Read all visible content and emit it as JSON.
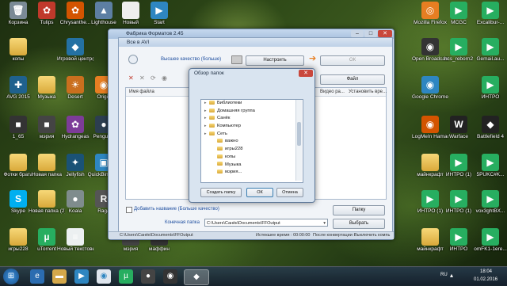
{
  "desktop": {
    "left_icons": [
      {
        "label": "Корзина",
        "glyph": "🗑",
        "color": "#7a8a95"
      },
      {
        "label": "Tulips",
        "glyph": "✿",
        "color": "#c0392b"
      },
      {
        "label": "Chrysanthe...",
        "glyph": "✿",
        "color": "#d35400"
      },
      {
        "label": "Lighthouse",
        "glyph": "▲",
        "color": "#5d7fa3"
      },
      {
        "label": "Новый",
        "glyph": "",
        "color": "#eeeeee"
      },
      {
        "label": "Start",
        "glyph": "▶",
        "color": "#2e86c1"
      },
      {
        "label": "копы",
        "glyph": "",
        "color": "folder"
      },
      {
        "label": "Игровой центр@Ma...",
        "glyph": "◆",
        "color": "#2471a3"
      },
      {
        "label": "AVG 2015",
        "glyph": "✚",
        "color": "#1f618d"
      },
      {
        "label": "Музыка",
        "glyph": "",
        "color": "folder"
      },
      {
        "label": "Desert",
        "glyph": "☀",
        "color": "#ca6f1e"
      },
      {
        "label": "Origin",
        "glyph": "◉",
        "color": "#e67e22"
      },
      {
        "label": "1_65",
        "glyph": "■",
        "color": "#333333"
      },
      {
        "label": "мэрия",
        "glyph": "■",
        "color": "#444444"
      },
      {
        "label": "Hydrangeas",
        "glyph": "✿",
        "color": "#7d3c98"
      },
      {
        "label": "Penguins",
        "glyph": "●",
        "color": "#2c3e50"
      },
      {
        "label": "Фотки брата",
        "glyph": "",
        "color": "folder"
      },
      {
        "label": "Новая папка",
        "glyph": "",
        "color": "folder"
      },
      {
        "label": "Jellyfish",
        "glyph": "✦",
        "color": "#1a5276"
      },
      {
        "label": "QuickBinder 3",
        "glyph": "▣",
        "color": "#2e86c1"
      },
      {
        "label": "Skype",
        "glyph": "S",
        "color": "#00aff0"
      },
      {
        "label": "Новая папка (2)",
        "glyph": "",
        "color": "folder"
      },
      {
        "label": "Koala",
        "glyph": "●",
        "color": "#7f8c8d"
      },
      {
        "label": "Raga",
        "glyph": "R",
        "color": "#555555"
      },
      {
        "label": "игры228",
        "glyph": "",
        "color": "folder"
      },
      {
        "label": "uTorrent",
        "glyph": "µ",
        "color": "#27ae60"
      },
      {
        "label": "Новый текстовый...",
        "glyph": "≡",
        "color": "#ecf0f1"
      },
      {
        "label": "мэрия",
        "glyph": "■",
        "color": "#444444"
      },
      {
        "label": "маффин",
        "glyph": "■",
        "color": "#333333"
      }
    ],
    "right_icons": [
      {
        "label": "Mozilla Firefox",
        "glyph": "◎",
        "color": "#e67e22"
      },
      {
        "label": "MCGC",
        "glyph": "▶",
        "color": "#27ae60"
      },
      {
        "label": "Excalibur-...",
        "glyph": "▶",
        "color": "#27ae60"
      },
      {
        "label": "Open Broadcast...",
        "glyph": "◉",
        "color": "#333333"
      },
      {
        "label": "hcs_reborn2",
        "glyph": "▶",
        "color": "#27ae60"
      },
      {
        "label": "Gemail.au...",
        "glyph": "▶",
        "color": "#27ae60"
      },
      {
        "label": "Google Chrome",
        "glyph": "◉",
        "color": "#2e86c1"
      },
      {
        "label": "ИНТРО",
        "glyph": "▶",
        "color": "#27ae60"
      },
      {
        "label": "LogMeIn Hamachi",
        "glyph": "◉",
        "color": "#d35400"
      },
      {
        "label": "Warface",
        "glyph": "W",
        "color": "#222222"
      },
      {
        "label": "Battlefield 4",
        "glyph": "◆",
        "color": "#222222"
      },
      {
        "label": "майнкрафт",
        "glyph": "",
        "color": "folder"
      },
      {
        "label": "ИНТРО (1)",
        "glyph": "▶",
        "color": "#27ae60"
      },
      {
        "label": "5PUKC#K...",
        "glyph": "▶",
        "color": "#27ae60"
      },
      {
        "label": "ИНТРО (1)",
        "glyph": "▶",
        "color": "#27ae60"
      },
      {
        "label": "ИНТРО (1)",
        "glyph": "▶",
        "color": "#27ae60"
      },
      {
        "label": "vox3ghtBX...",
        "glyph": "▶",
        "color": "#27ae60"
      },
      {
        "label": "майнкрафт",
        "glyph": "",
        "color": "folder"
      },
      {
        "label": "ИНТРО",
        "glyph": "▶",
        "color": "#27ae60"
      },
      {
        "label": "omFK1-1ere...",
        "glyph": "▶",
        "color": "#27ae60"
      }
    ]
  },
  "app_window": {
    "title": "Фабрика Форматов 2.45",
    "inner_title": "Все в AVI",
    "quality_label": "Высшее качество (больше)",
    "settings_button": "Настроить",
    "ok_button": "ОК",
    "file_button": "Файл",
    "columns": [
      "Имя файла",
      "Видео ра...",
      "Установить вре..."
    ],
    "add_name_checkbox": "Добавить название (Больше качество)",
    "folder_button": "Папку",
    "dest_label": "Конечная папка",
    "dest_path": "C:\\Users\\Санёк\\Documents\\FFOutput",
    "choose_button": "Выбрать",
    "status_path": "C:\\Users\\Санёк\\Documents\\FFOutput",
    "status_time": "Истекшее время : 00:00:00",
    "status_after": "После конвертации :",
    "status_shutdown": "Выключить компь"
  },
  "dialog": {
    "title": "Обзор папок",
    "tree": [
      {
        "label": "Библиотеки",
        "level": 0,
        "arrow": true
      },
      {
        "label": "Домашняя группа",
        "level": 0,
        "arrow": true
      },
      {
        "label": "Санёк",
        "level": 0,
        "arrow": true
      },
      {
        "label": "Компьютер",
        "level": 0,
        "arrow": true
      },
      {
        "label": "Сеть",
        "level": 0,
        "arrow": true
      },
      {
        "label": "важно",
        "level": 1,
        "arrow": false
      },
      {
        "label": "игры228",
        "level": 1,
        "arrow": false
      },
      {
        "label": "копы",
        "level": 1,
        "arrow": false
      },
      {
        "label": "Музыка",
        "level": 1,
        "arrow": false
      },
      {
        "label": "мэрия...",
        "level": 1,
        "arrow": false
      }
    ],
    "create_folder_button": "Создать папку",
    "ok_button": "ОК",
    "cancel_button": "Отмена"
  },
  "taskbar": {
    "language": "RU",
    "time": "18:04",
    "date": "01.02.2016"
  }
}
